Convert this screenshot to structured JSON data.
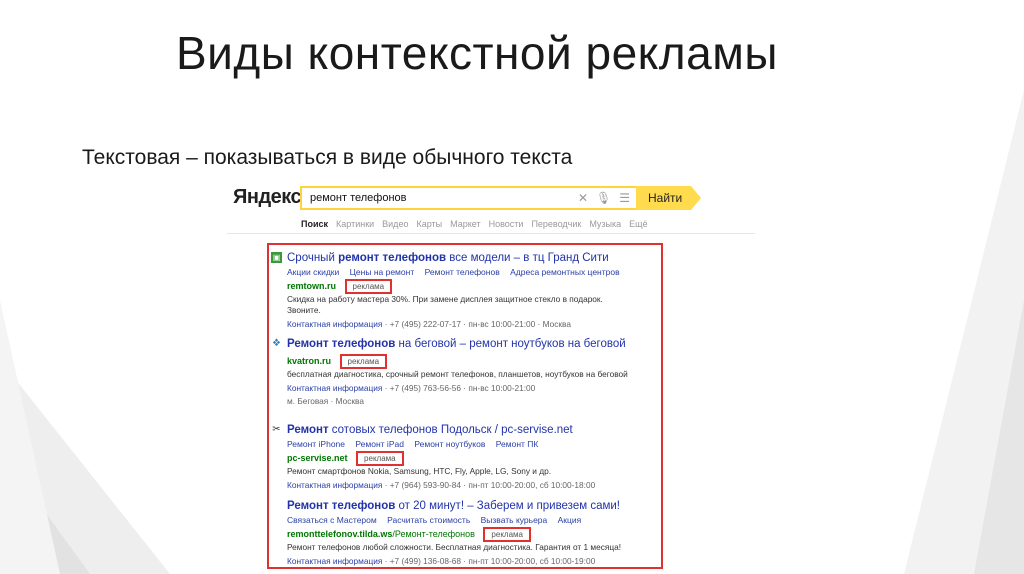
{
  "slide": {
    "title": "Виды контекстной рекламы",
    "subtitle": "Текстовая – показываться в виде обычного текста"
  },
  "serp": {
    "logo": "Яндекс",
    "query": "ремонт телефонов",
    "search_button": "Найти",
    "tabs": [
      "Поиск",
      "Картинки",
      "Видео",
      "Карты",
      "Маркет",
      "Новости",
      "Переводчик",
      "Музыка",
      "Ещё"
    ],
    "ad_label": "реклама",
    "ads": [
      {
        "icon": "remtown-favicon-icon",
        "title_a": "Срочный ",
        "title_b": "ремонт телефонов",
        "title_c": " все модели – в тц Гранд Сити",
        "sitelinks": [
          "Акции скидки",
          "Цены на ремонт",
          "Ремонт телефонов",
          "Адреса ремонтных центров"
        ],
        "domain": "remtown.ru",
        "domain_path": "",
        "desc": "Скидка на работу мастера 30%. При замене дисплея защитное стекло в подарок. Звоните.",
        "contact_label": "Контактная информация",
        "contact_rest": " · +7 (495) 222-07-17 · пн-вс 10:00-21:00 · Москва"
      },
      {
        "icon": "kvatron-favicon-icon",
        "title_a": "",
        "title_b": "Ремонт телефонов",
        "title_c": " на беговой – ремонт ноутбуков на беговой",
        "sitelinks": [],
        "domain": "kvatron.ru",
        "domain_path": "",
        "desc": "бесплатная диагностика, срочный ремонт телефонов, планшетов, ноутбуков на беговой",
        "contact_label": "Контактная информация",
        "contact_rest": " · +7 (495) 763-56-56 · пн-вс 10:00-21:00",
        "extra": "м. Беговая · Москва"
      },
      {
        "icon": "tools-icon",
        "title_a": "Ремонт",
        "title_b": " сотовых телефонов",
        "title_c": " Подольск / pc-servise.net",
        "sitelinks": [
          "Ремонт iPhone",
          "Ремонт iPad",
          "Ремонт ноутбуков",
          "Ремонт ПК"
        ],
        "domain": "pc-servise.net",
        "domain_path": "",
        "desc": "Ремонт смартфонов Nokia, Samsung, HTC, Fly, Apple, LG, Sony и др.",
        "contact_label": "Контактная информация",
        "contact_rest": " · +7 (964) 593-90-84 · пн-пт 10:00-20:00, сб 10:00-18:00"
      },
      {
        "icon": "",
        "title_a": "",
        "title_b": "Ремонт телефонов",
        "title_c": " от 20 минут! – Заберем и привезем сами!",
        "sitelinks": [
          "Связаться с Мастером",
          "Расчитать стоимость",
          "Вызвать курьера",
          "Акция"
        ],
        "domain": "remonttelefonov.tilda.ws",
        "domain_path": "/Ремонт-телефонов",
        "desc": "Ремонт телефонов любой сложности. Бесплатная диагностика. Гарантия от 1 месяца!",
        "contact_label": "Контактная информация",
        "contact_rest": " · +7 (499) 136-08-68 · пн-пт 10:00-20:00, сб 10:00-19:00"
      }
    ]
  }
}
